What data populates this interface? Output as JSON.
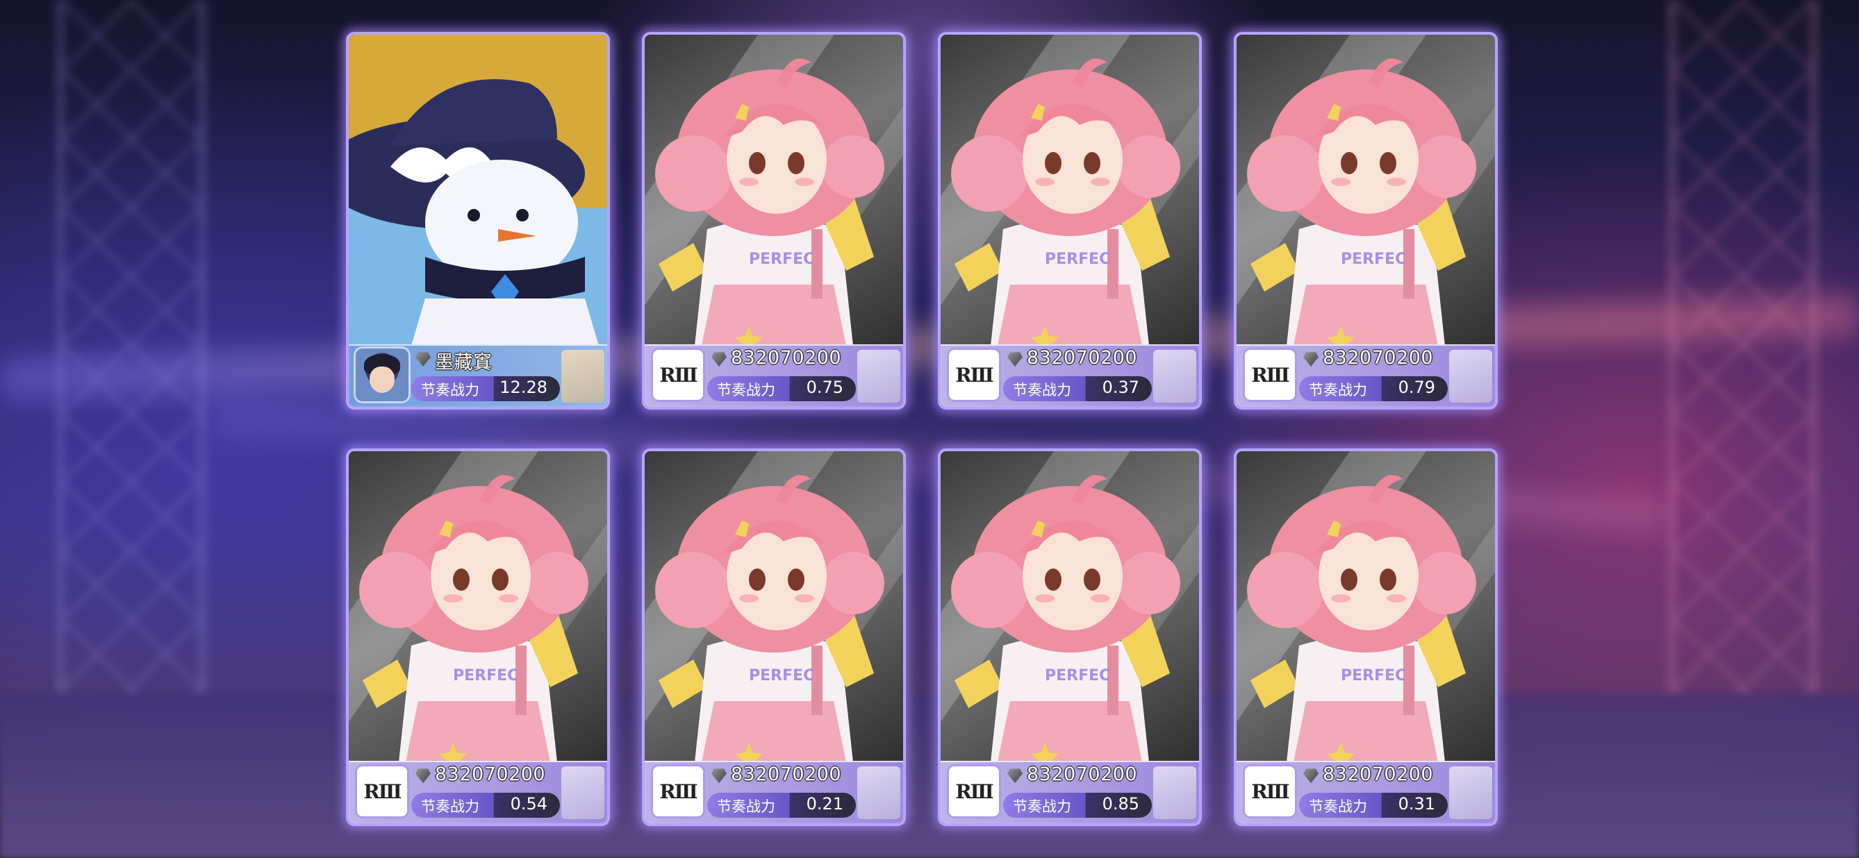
{
  "cards": [
    {
      "variant": "special",
      "art_name": "witch-snowman-art",
      "name": "墨藏窴",
      "power_label": "节奏战力",
      "power": "12.28",
      "logo": ""
    },
    {
      "variant": "common",
      "art_name": "pink-hair-idol-art",
      "name": "832070200",
      "power_label": "节奏战力",
      "power": "0.75",
      "logo": "RⅢ"
    },
    {
      "variant": "common",
      "art_name": "pink-hair-idol-art",
      "name": "832070200",
      "power_label": "节奏战力",
      "power": "0.37",
      "logo": "RⅢ"
    },
    {
      "variant": "common",
      "art_name": "pink-hair-idol-art",
      "name": "832070200",
      "power_label": "节奏战力",
      "power": "0.79",
      "logo": "RⅢ"
    },
    {
      "variant": "common",
      "art_name": "pink-hair-idol-art",
      "name": "832070200",
      "power_label": "节奏战力",
      "power": "0.54",
      "logo": "RⅢ"
    },
    {
      "variant": "common",
      "art_name": "pink-hair-idol-art",
      "name": "832070200",
      "power_label": "节奏战力",
      "power": "0.21",
      "logo": "RⅢ"
    },
    {
      "variant": "common",
      "art_name": "pink-hair-idol-art",
      "name": "832070200",
      "power_label": "节奏战力",
      "power": "0.85",
      "logo": "RⅢ"
    },
    {
      "variant": "common",
      "art_name": "pink-hair-idol-art",
      "name": "832070200",
      "power_label": "节奏战力",
      "power": "0.31",
      "logo": "RⅢ"
    }
  ],
  "icons": {
    "gem": "gem-icon"
  },
  "colors": {
    "card_border": "#b6a4ff",
    "card_glow": "#aa8cff",
    "pill_purple": "#8f7be6",
    "pink_hair": "#f08fa2",
    "witch_hat": "#2a2c5a",
    "gold_bg": "#d7a83a"
  }
}
